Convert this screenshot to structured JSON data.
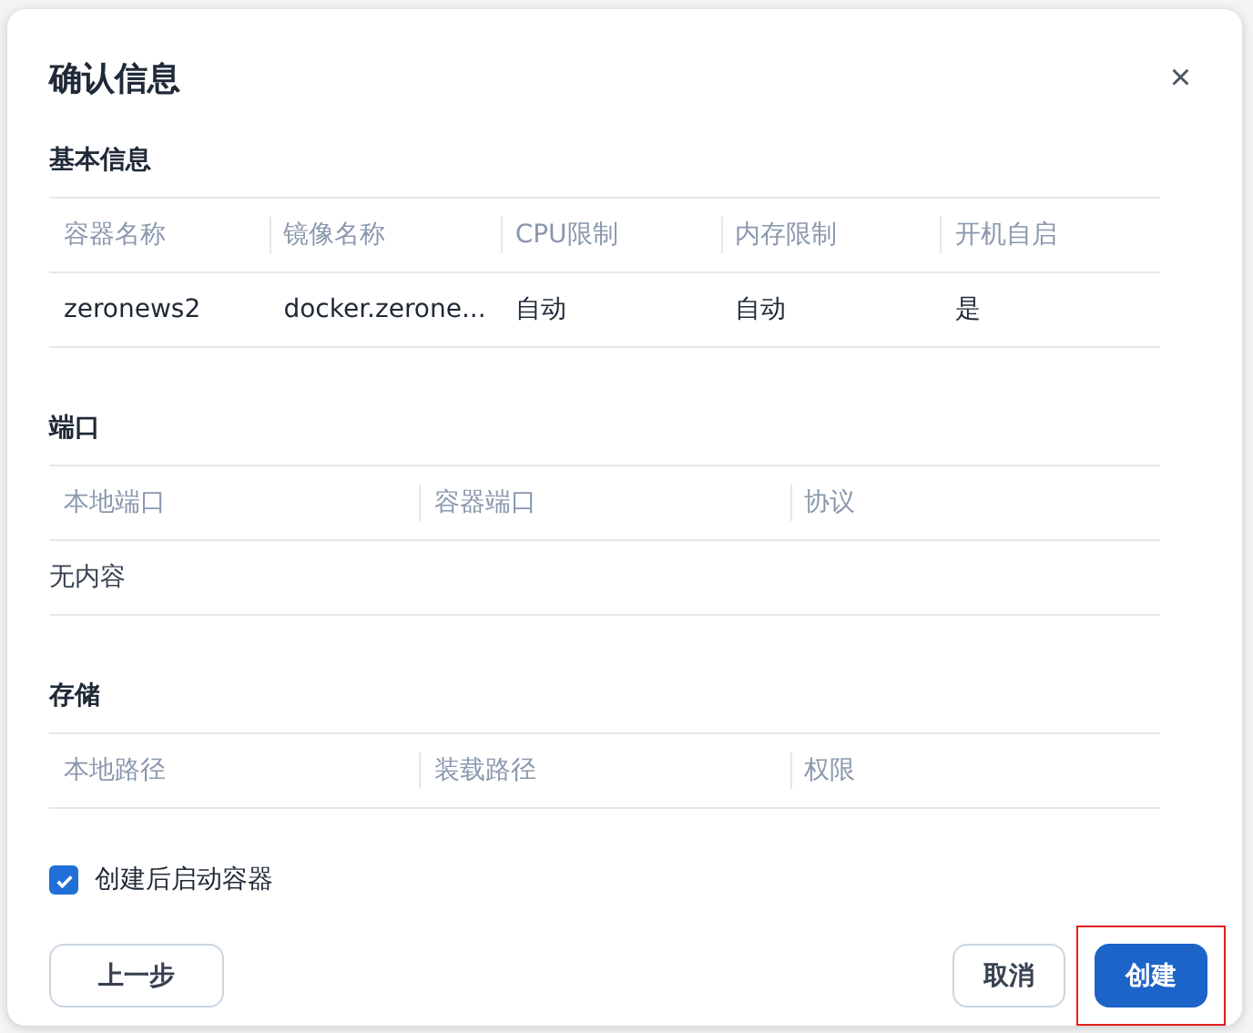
{
  "dialog": {
    "title": "确认信息",
    "close": "×"
  },
  "sections": [
    {
      "title": "基本信息",
      "columns": [
        "容器名称",
        "镜像名称",
        "CPU限制",
        "内存限制",
        "开机自启"
      ],
      "rows": [
        [
          "zeronews2",
          "docker.zerone...",
          "自动",
          "自动",
          "是"
        ]
      ]
    },
    {
      "title": "端口",
      "columns": [
        "本地端口",
        "容器端口",
        "协议"
      ],
      "empty_text": "无内容"
    },
    {
      "title": "存储",
      "columns": [
        "本地路径",
        "装载路径",
        "权限"
      ]
    }
  ],
  "start_after_create": {
    "label": "创建后启动容器",
    "checked": true
  },
  "buttons": [
    {
      "label": "上一步",
      "kind": "secondary",
      "highlighted": false
    },
    {
      "label": "取消",
      "kind": "secondary",
      "highlighted": false
    },
    {
      "label": "创建",
      "kind": "primary",
      "highlighted": true
    }
  ]
}
